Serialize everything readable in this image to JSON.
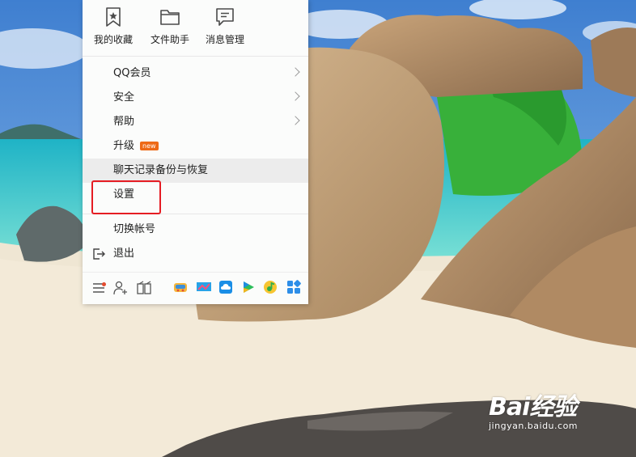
{
  "quick_actions": [
    {
      "label": "我的收藏",
      "icon": "star-bookmark-icon"
    },
    {
      "label": "文件助手",
      "icon": "folder-icon"
    },
    {
      "label": "消息管理",
      "icon": "message-icon"
    }
  ],
  "menu": {
    "qq_member": "QQ会员",
    "security": "安全",
    "help": "帮助",
    "upgrade": "升级",
    "upgrade_badge": "new",
    "chat_backup": "聊天记录备份与恢复",
    "settings": "设置",
    "switch_account": "切换帐号",
    "exit": "退出"
  },
  "highlight_color": "#e51c23",
  "watermark": {
    "brand": "Bai经验",
    "url": "jingyan.baidu.com"
  }
}
